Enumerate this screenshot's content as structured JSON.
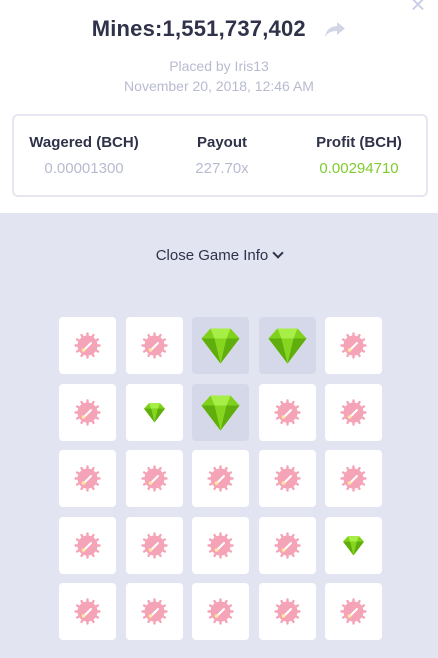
{
  "header": {
    "title": "Mines:1,551,737,402",
    "placed_by": "Placed by Iris13",
    "date": "November 20, 2018, 12:46 AM"
  },
  "stats": {
    "wagered_label": "Wagered (BCH)",
    "wagered_value": "0.00001300",
    "payout_label": "Payout",
    "payout_value": "227.70x",
    "profit_label": "Profit (BCH)",
    "profit_value": "0.00294710"
  },
  "toggle": {
    "label": "Close Game Info"
  },
  "colors": {
    "gem": "#7fd11b",
    "mine": "#f5a3b6",
    "profit": "#7fcb2e",
    "board_bg": "#e2e4f1"
  },
  "grid": {
    "rows": 5,
    "cols": 5,
    "tiles": [
      [
        "mine",
        "mine",
        "gem-revealed",
        "gem-revealed",
        "mine"
      ],
      [
        "mine",
        "gem-small",
        "gem-revealed",
        "mine",
        "mine"
      ],
      [
        "mine",
        "mine",
        "mine",
        "mine",
        "mine"
      ],
      [
        "mine",
        "mine",
        "mine",
        "mine",
        "gem-small"
      ],
      [
        "mine",
        "mine",
        "mine",
        "mine",
        "mine"
      ]
    ]
  }
}
